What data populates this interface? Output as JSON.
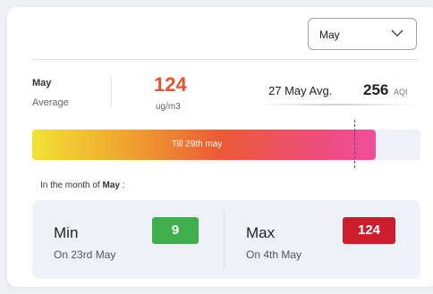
{
  "month_select": {
    "value": "May",
    "icon": "chevron-down-icon"
  },
  "summary": {
    "month": "May",
    "average_label": "Average",
    "average_value": "124",
    "average_unit": "ug/m3",
    "avg27_label": "27 May Avg.",
    "avg27_value": "256",
    "avg27_unit": "AQI"
  },
  "progress": {
    "label": "Till 29th may",
    "fill_fraction": 0.885,
    "marker_fraction": 0.83
  },
  "month_note": {
    "prefix": "In the month of ",
    "month": "May",
    "suffix": " :"
  },
  "stats": {
    "min": {
      "title": "Min",
      "date": "On 23rd May",
      "value": "9",
      "color": "#3fb04c"
    },
    "max": {
      "title": "Max",
      "date": "On 4th May",
      "value": "124",
      "color": "#cc1f2d"
    }
  }
}
